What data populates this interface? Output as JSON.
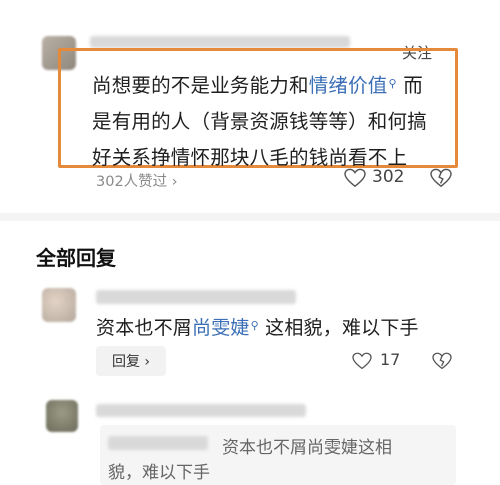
{
  "top_comment": {
    "follow_label": "关注",
    "text_part1": "尚想要的不是业务能力和",
    "link1": "情绪价值",
    "text_part2": "而",
    "line2": "是有用的人（背景资源钱等等）和何搞",
    "line3": "好关系挣情怀那块八毛的钱尚看不上",
    "likes_link": "302人赞过 ›",
    "like_count": "302",
    "accent_color": "#e58a3a"
  },
  "section": {
    "title": "全部回复"
  },
  "reply1": {
    "text_part1": "资本也不屑",
    "link": "尚雯婕",
    "text_part2": "这相貌，难以下手",
    "reply_button": "回复 ›",
    "like_count": "17"
  },
  "reply2": {
    "quote_line1": "资本也不屑尚雯婕这相",
    "quote_line2": "貌，难以下手"
  },
  "icons": [
    "heart-icon",
    "dislike-icon",
    "search-icon"
  ]
}
